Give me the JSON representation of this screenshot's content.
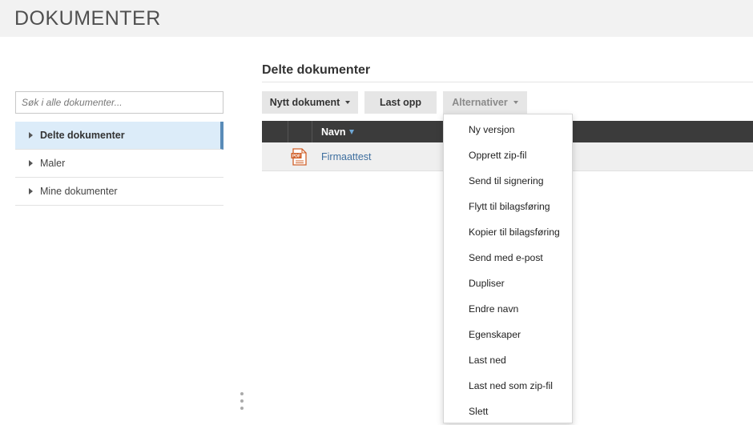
{
  "app": {
    "title": "DOKUMENTER"
  },
  "sidebar": {
    "search_placeholder": "Søk i alle dokumenter...",
    "items": [
      {
        "label": "Delte dokumenter",
        "active": true
      },
      {
        "label": "Maler",
        "active": false
      },
      {
        "label": "Mine dokumenter",
        "active": false
      }
    ]
  },
  "main": {
    "title": "Delte dokumenter",
    "toolbar": {
      "new_label": "Nytt dokument",
      "upload_label": "Last opp",
      "options_label": "Alternativer"
    },
    "table": {
      "column_name": "Navn",
      "rows": [
        {
          "file_type": "pdf-icon",
          "name": "Firmaattest"
        }
      ]
    }
  },
  "dropdown": {
    "items": [
      "Ny versjon",
      "Opprett zip-fil",
      "Send til signering",
      "Flytt til bilagsføring",
      "Kopier til bilagsføring",
      "Send med e-post",
      "Dupliser",
      "Endre navn",
      "Egenskaper",
      "Last ned",
      "Last ned som zip-fil",
      "Slett"
    ]
  },
  "colors": {
    "active_nav_bg": "#dcecf9",
    "active_nav_accent": "#5a8cb8",
    "link": "#3f6f9f",
    "table_header": "#3b3b3b",
    "pdf_icon": "#d0602a"
  }
}
